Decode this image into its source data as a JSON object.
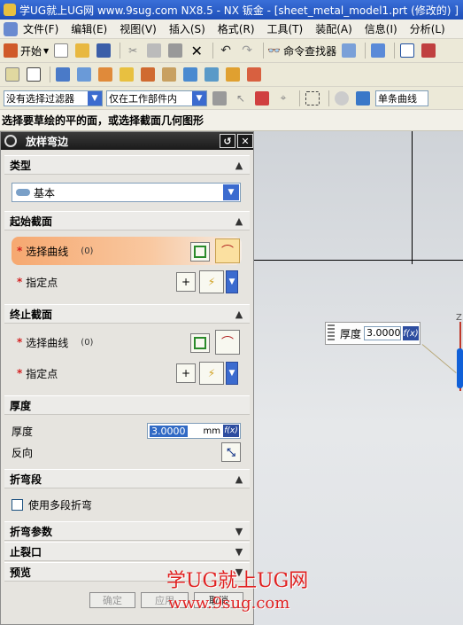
{
  "window": {
    "title": "学UG就上UG网 www.9sug.com NX8.5 - NX 钣金 - [sheet_metal_model1.prt  (修改的) ]"
  },
  "menubar": {
    "items": [
      "文件(F)",
      "编辑(E)",
      "视图(V)",
      "插入(S)",
      "格式(R)",
      "工具(T)",
      "装配(A)",
      "信息(I)",
      "分析(L)"
    ]
  },
  "toolbar1": {
    "start_label": "开始",
    "command_finder_label": "命令查找器"
  },
  "selection_bar": {
    "filter_value": "没有选择过滤器",
    "scope_value": "仅在工作部件内",
    "curve_rule_value": "单条曲线"
  },
  "cue_line": "选择要草绘的平的面，或选择截面几何图形",
  "dialog": {
    "title": "放样弯边",
    "type_section": {
      "label": "类型",
      "value": "基本"
    },
    "start_section": {
      "label": "起始截面",
      "select_curve_label": "选择曲线",
      "select_curve_count": "(0)",
      "specify_point_label": "指定点"
    },
    "end_section": {
      "label": "终止截面",
      "select_curve_label": "选择曲线",
      "select_curve_count": "(0)",
      "specify_point_label": "指定点"
    },
    "thickness_section": {
      "label": "厚度",
      "thickness_label": "厚度",
      "thickness_value": "3.0000",
      "unit": "mm",
      "fx_label": "f(x)",
      "reverse_label": "反向"
    },
    "bend_segment_section": {
      "label": "折弯段",
      "multi_segment_label": "使用多段折弯"
    },
    "bend_params_label": "折弯参数",
    "relief_label": "止裂口",
    "preview_label": "预览",
    "buttons": {
      "ok": "确定",
      "apply": "应用",
      "cancel": "取消"
    }
  },
  "graphics": {
    "float_thickness_label": "厚度",
    "float_thickness_value": "3.0000",
    "float_fx_label": "f(x)",
    "axis_label": "Z"
  },
  "watermark": {
    "line1": "学UG就上UG网",
    "line2": "www.9sug.com"
  }
}
